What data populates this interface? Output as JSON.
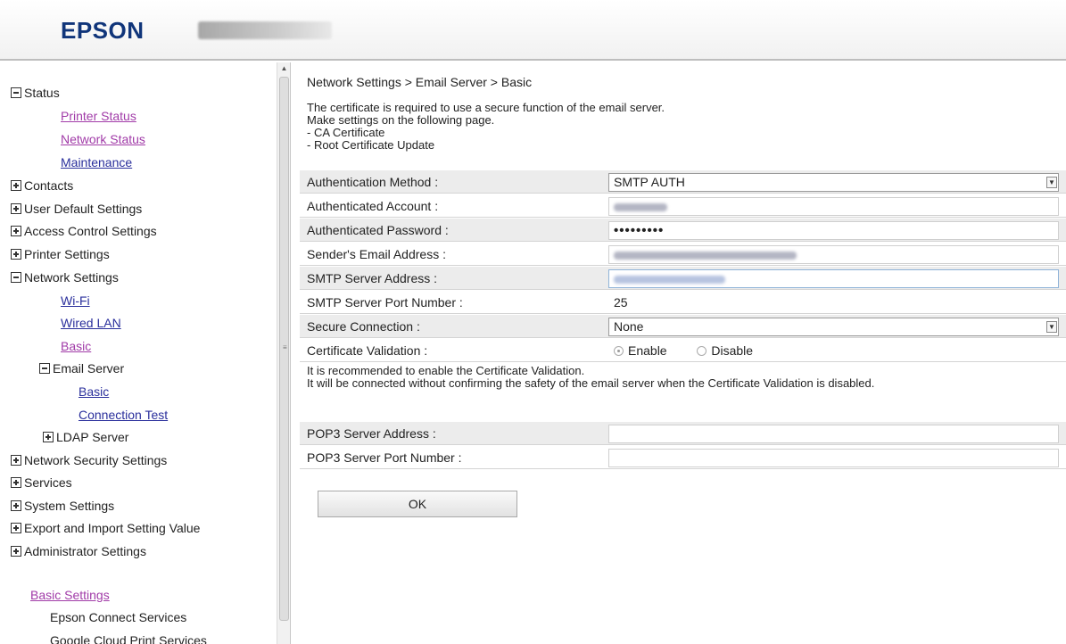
{
  "header": {
    "brand": "EPSON"
  },
  "sidebar": {
    "status": "Status",
    "printer_status": "Printer Status",
    "network_status": "Network Status",
    "maintenance": "Maintenance",
    "contacts": "Contacts",
    "user_default_settings": "User Default Settings",
    "access_control_settings": "Access Control Settings",
    "printer_settings": "Printer Settings",
    "network_settings": "Network Settings",
    "wifi": "Wi-Fi",
    "wired_lan": "Wired LAN",
    "basic": "Basic",
    "email_server": "Email Server",
    "email_basic": "Basic",
    "connection_test": "Connection Test",
    "ldap_server": "LDAP Server",
    "network_security_settings": "Network Security Settings",
    "services": "Services",
    "system_settings": "System Settings",
    "export_import": "Export and Import Setting Value",
    "administrator_settings": "Administrator Settings",
    "basic_settings": "Basic Settings",
    "epson_connect": "Epson Connect Services",
    "google_cloud": "Google Cloud Print Services"
  },
  "main": {
    "breadcrumb": "Network Settings > Email Server > Basic",
    "intro": [
      "The certificate is required to use a secure function of the email server.",
      "Make settings on the following page.",
      "- CA Certificate",
      "- Root Certificate Update"
    ],
    "fields": {
      "auth_method": {
        "label": "Authentication Method :",
        "value": "SMTP AUTH"
      },
      "auth_account": {
        "label": "Authenticated Account :"
      },
      "auth_password": {
        "label": "Authenticated Password :",
        "value": "•••••••••"
      },
      "sender_email": {
        "label": "Sender's Email Address :"
      },
      "smtp_address": {
        "label": "SMTP Server Address :"
      },
      "smtp_port": {
        "label": "SMTP Server Port Number :",
        "value": "25"
      },
      "secure_connection": {
        "label": "Secure Connection :",
        "value": "None"
      },
      "cert_validation": {
        "label": "Certificate Validation :",
        "enable": "Enable",
        "disable": "Disable",
        "selected": "Enable"
      },
      "pop3_address": {
        "label": "POP3 Server Address :",
        "value": ""
      },
      "pop3_port": {
        "label": "POP3 Server Port Number :",
        "value": ""
      }
    },
    "notes": [
      "It is recommended to enable the Certificate Validation.",
      "It will be connected without confirming the safety of the email server when the Certificate Validation is disabled."
    ],
    "ok_label": "OK"
  }
}
